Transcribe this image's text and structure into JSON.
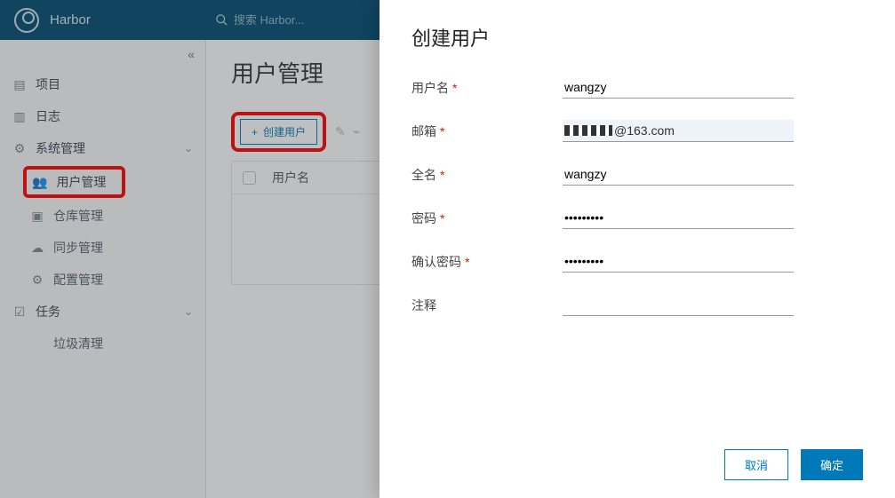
{
  "header": {
    "app_name": "Harbor",
    "search_placeholder": "搜索 Harbor..."
  },
  "sidebar": {
    "items": [
      {
        "icon": "projects-icon",
        "label": "项目"
      },
      {
        "icon": "logs-icon",
        "label": "日志"
      },
      {
        "icon": "system-icon",
        "label": "系统管理",
        "expandable": true
      },
      {
        "icon": "users-icon",
        "label": "用户管理",
        "active": true
      },
      {
        "icon": "repo-icon",
        "label": "仓库管理"
      },
      {
        "icon": "sync-icon",
        "label": "同步管理"
      },
      {
        "icon": "config-icon",
        "label": "配置管理"
      },
      {
        "icon": "tasks-icon",
        "label": "任务",
        "expandable": true
      },
      {
        "icon": "blank-icon",
        "label": "垃圾清理"
      }
    ]
  },
  "main": {
    "title": "用户管理",
    "create_button": "创建用户",
    "table": {
      "col_user": "用户名"
    }
  },
  "modal": {
    "title": "创建用户",
    "fields": {
      "username": {
        "label": "用户名",
        "required": true,
        "value": "wangzy"
      },
      "email": {
        "label": "邮箱",
        "required": true,
        "value_suffix": "@163.com"
      },
      "fullname": {
        "label": "全名",
        "required": true,
        "value": "wangzy"
      },
      "password": {
        "label": "密码",
        "required": true,
        "value": "•••••••••"
      },
      "confirm": {
        "label": "确认密码",
        "required": true,
        "value": "•••••••••"
      },
      "comment": {
        "label": "注释",
        "required": false,
        "value": ""
      }
    },
    "buttons": {
      "cancel": "取消",
      "ok": "确定"
    }
  }
}
